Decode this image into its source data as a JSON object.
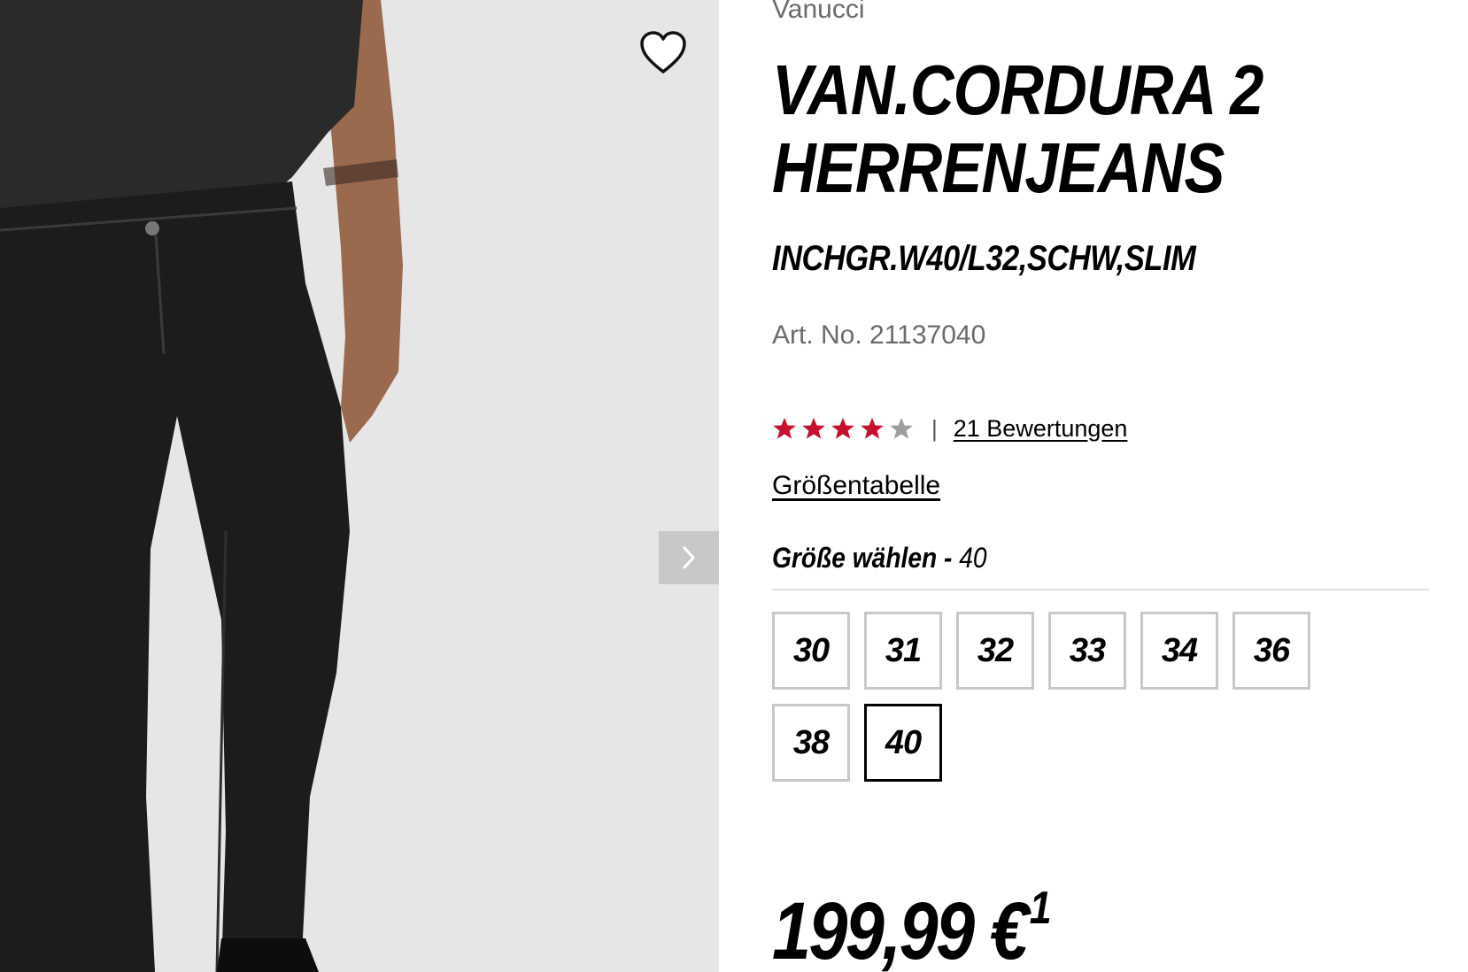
{
  "brand": "Vanucci",
  "product": {
    "title_line1": "VAN.CORDURA 2",
    "title_line2": "HERRENJEANS",
    "variant": "INCHGR.W40/L32,SCHW,SLIM",
    "art_no": "Art. No. 21137040"
  },
  "rating": {
    "value": 4,
    "max": 5,
    "separator": "|",
    "reviews_label": "21 Bewertungen",
    "star_color": "#c8102e",
    "star_empty_color": "#9e9e9e"
  },
  "size_chart_label": "Größentabelle",
  "size_select": {
    "label": "Größe wählen - ",
    "selected": "40",
    "options": [
      "30",
      "31",
      "32",
      "33",
      "34",
      "36",
      "38",
      "40"
    ]
  },
  "price": {
    "amount": "199,99 €",
    "footnote": "1"
  },
  "icons": {
    "wishlist": "heart-outline-icon",
    "next": "chevron-right-icon"
  }
}
